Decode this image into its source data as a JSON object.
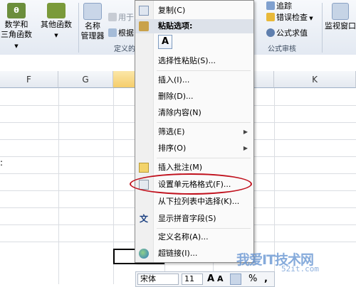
{
  "ribbon": {
    "btn_math": "数学和\n三角函数",
    "btn_other": "其他函数",
    "btn_name_manager": "名称\n管理器",
    "use_in_formula": "用于",
    "create_from_selection": "根据",
    "group_defined_names": "定义的",
    "trace_label": "追踪",
    "error_check": "错误检查",
    "evaluate_formula": "公式求值",
    "group_formula_auditing": "公式审核",
    "watch_window": "监视窗口"
  },
  "columns": [
    "F",
    "G",
    "H",
    "I",
    "J",
    "K"
  ],
  "menu": {
    "copy": "复制(C)",
    "paste_options_header": "粘贴选项:",
    "paste_icon_letter": "A",
    "paste_special": "选择性粘贴(S)...",
    "insert": "插入(I)...",
    "delete": "删除(D)...",
    "clear_contents": "清除内容(N)",
    "filter": "筛选(E)",
    "sort": "排序(O)",
    "insert_comment": "插入批注(M)",
    "format_cells": "设置单元格格式(F)...",
    "pick_from_list": "从下拉列表中选择(K)...",
    "show_phonetic": "显示拼音字段(S)",
    "define_name": "定义名称(A)...",
    "hyperlink": "超链接(I)...",
    "phonetic_icon_text": "文"
  },
  "mini_toolbar": {
    "font_name": "宋体",
    "font_size": "11",
    "grow_font": "A",
    "shrink_font": "A",
    "percent": "%",
    "comma": ","
  },
  "watermark": {
    "main": "我爱IT技术网",
    "sub": "52it.com"
  },
  "left_glyph": ":"
}
